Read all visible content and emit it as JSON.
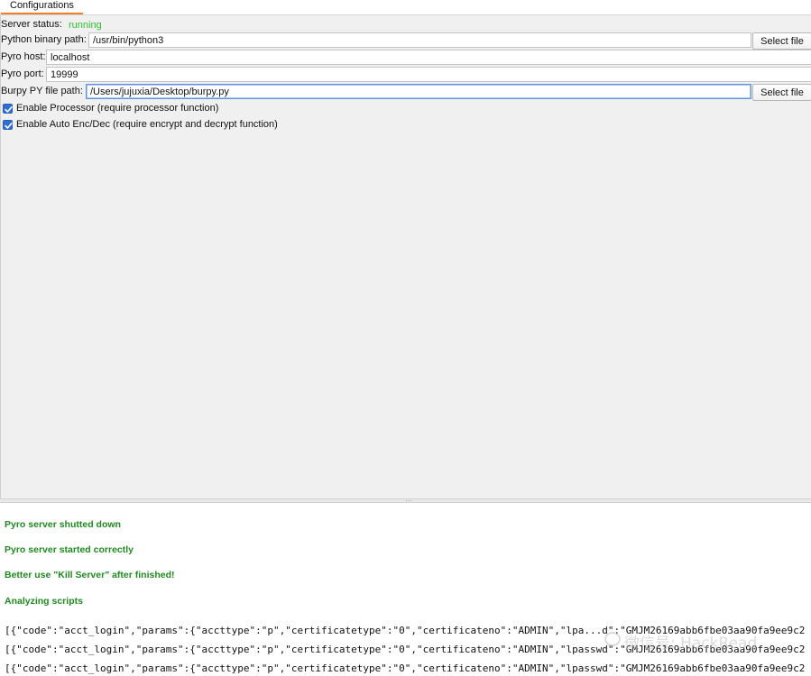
{
  "tabs": [
    {
      "label": "Configurations",
      "active": true
    }
  ],
  "config": {
    "server_status_label": "Server status:",
    "server_status_value": "running",
    "python_label": "Python binary path:",
    "python_value": "/usr/bin/python3",
    "pyro_host_label": "Pyro host:",
    "pyro_host_value": "localhost",
    "pyro_port_label": "Pyro port:",
    "pyro_port_value": "19999",
    "burpy_label": "Burpy PY file path:",
    "burpy_value": "/Users/jujuxia/Desktop/burpy.py",
    "select_file_label": "Select file",
    "enable_processor_label": "Enable Processor (require processor function)",
    "enable_processor_checked": true,
    "enable_auto_label": "Enable Auto Enc/Dec (require encrypt and decrypt function)",
    "enable_auto_checked": true
  },
  "colors": {
    "status_running": "#2ec12e",
    "log_message": "#1f8a1f",
    "tab_accent": "#ef7f2a",
    "checkbox": "#2f6fd5"
  },
  "splitter_grip": "···",
  "log": {
    "messages": [
      "Pyro server shutted down",
      "Pyro server started correctly",
      "Better use \"Kill Server\" after finished!",
      "Analyzing scripts"
    ],
    "json_lines": [
      "[{\"code\":\"acct_login\",\"params\":{\"accttype\":\"p\",\"certificatetype\":\"0\",\"certificateno\":\"ADMIN\",\"lpa...d\":\"GMJM26169abb6fbe03aa90fa9ee9c2",
      "[{\"code\":\"acct_login\",\"params\":{\"accttype\":\"p\",\"certificatetype\":\"0\",\"certificateno\":\"ADMIN\",\"lpasswd\":\"GMJM26169abb6fbe03aa90fa9ee9c2",
      "[{\"code\":\"acct_login\",\"params\":{\"accttype\":\"p\",\"certificatetype\":\"0\",\"certificateno\":\"ADMIN\",\"lpasswd\":\"GMJM26169abb6fbe03aa90fa9ee9c2"
    ]
  },
  "watermark": {
    "text": "微信号: HackRead",
    "icon": "wechat-icon"
  }
}
